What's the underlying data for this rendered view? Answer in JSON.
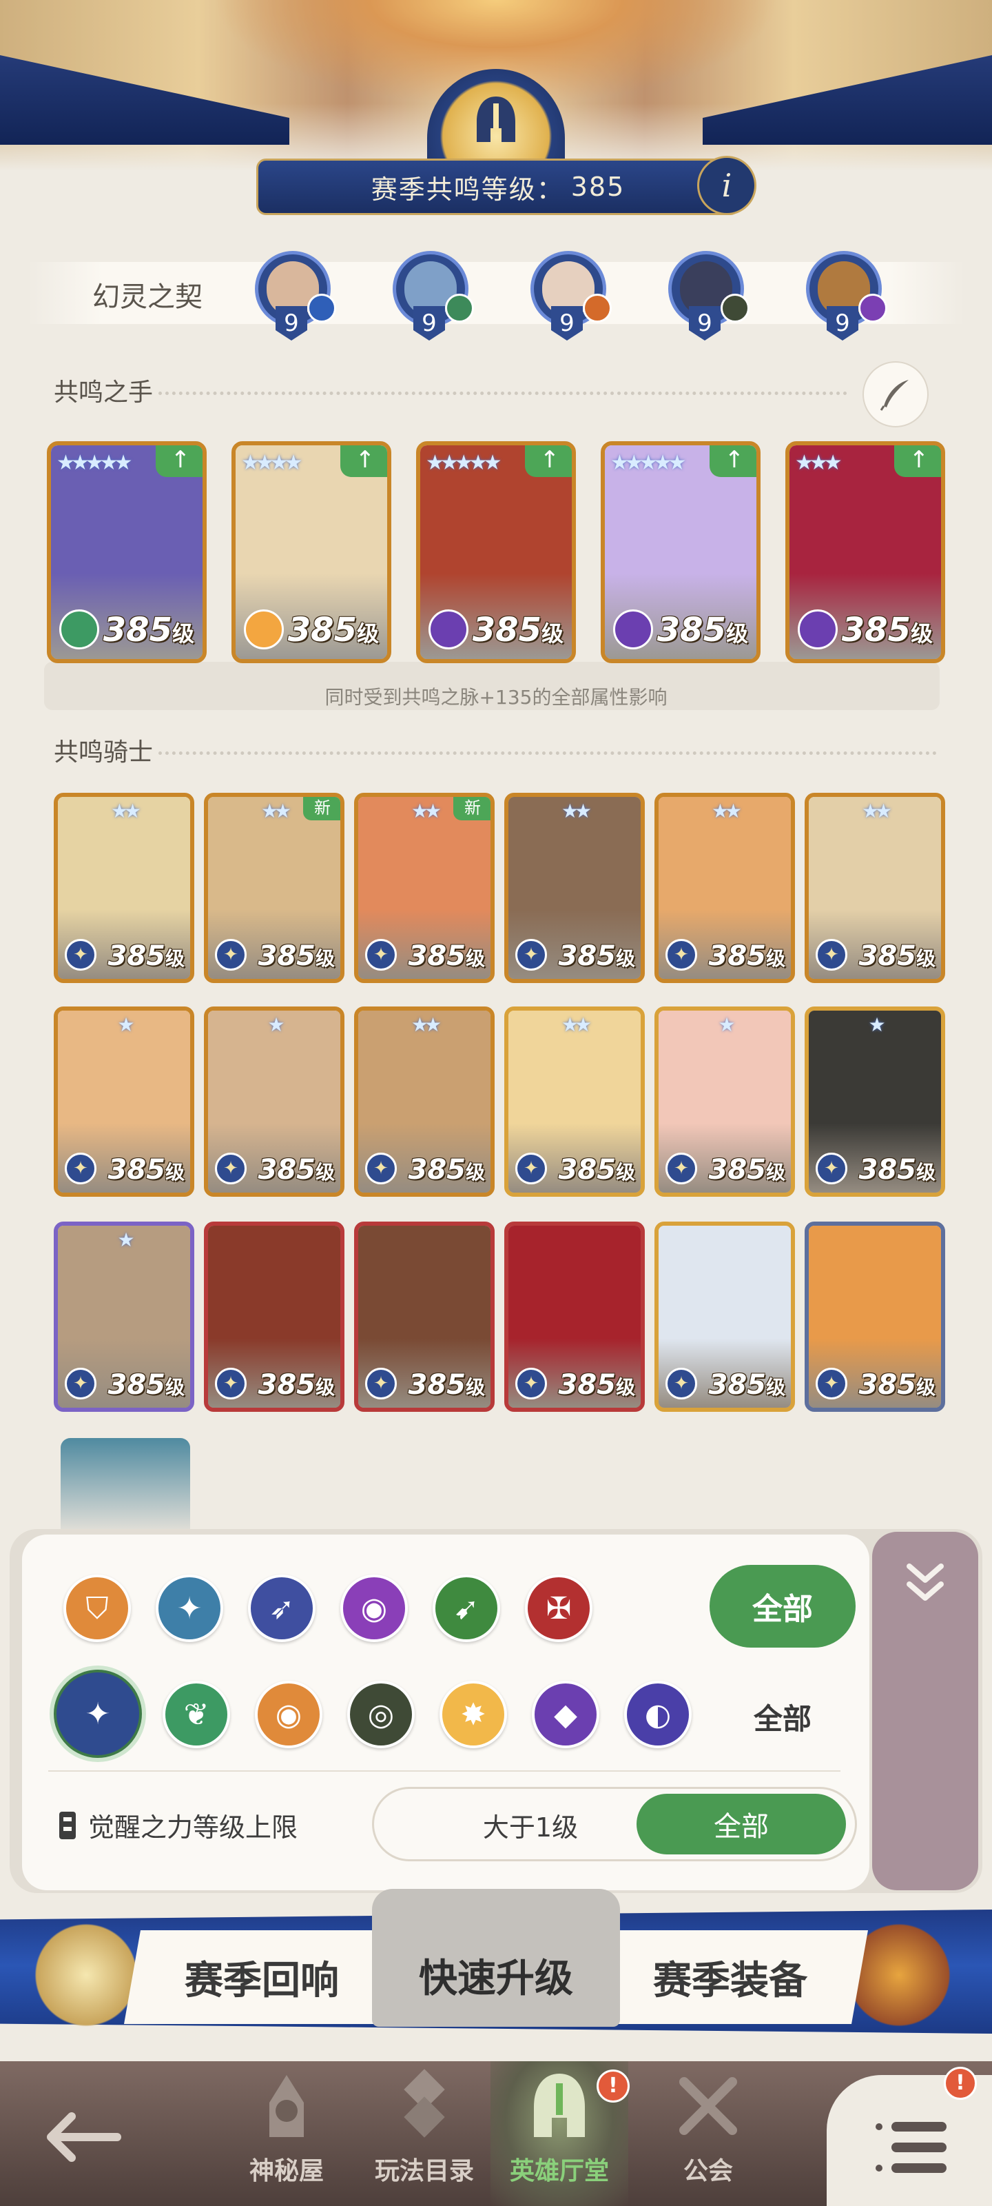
{
  "header": {
    "level_label": "赛季共鸣等级：",
    "level_value": "385",
    "info_label": "i"
  },
  "contract": {
    "title": "幻灵之契",
    "slots": [
      {
        "level": "9",
        "badge_color": "#2f5fb8",
        "face_color": "#d9b79c"
      },
      {
        "level": "9",
        "badge_color": "#3d8a5a",
        "face_color": "#7fa0c8"
      },
      {
        "level": "9",
        "badge_color": "#d46a2a",
        "face_color": "#e6d0bf"
      },
      {
        "level": "9",
        "badge_color": "#3f4a36",
        "face_color": "#3a3f5c"
      },
      {
        "level": "9",
        "badge_color": "#7b3fb3",
        "face_color": "#b07a3f"
      }
    ]
  },
  "hand": {
    "title": "共鸣之手",
    "note": "同时受到共鸣之脉+135的全部属性影响",
    "cards": [
      {
        "level": "385",
        "unit": "级",
        "stars": "★★★★★",
        "art": "#6a5fb3",
        "faction": "#3d9a63"
      },
      {
        "level": "385",
        "unit": "级",
        "stars": "★★★★",
        "art": "#e9d6b1",
        "faction": "#f3a640"
      },
      {
        "level": "385",
        "unit": "级",
        "stars": "★★★★★",
        "art": "#b0442f",
        "faction": "#6b3fb0"
      },
      {
        "level": "385",
        "unit": "级",
        "stars": "★★★★★",
        "art": "#c8b2e8",
        "faction": "#6b3fb0"
      },
      {
        "level": "385",
        "unit": "级",
        "stars": "★★★",
        "art": "#a8243f",
        "faction": "#6b3fb0"
      }
    ]
  },
  "knights": {
    "title": "共鸣骑士",
    "cards": [
      {
        "level": "385",
        "unit": "级",
        "stars": "★★",
        "new": "",
        "art": "#e6d3a3",
        "frame": "orange"
      },
      {
        "level": "385",
        "unit": "级",
        "stars": "★★",
        "new": "新",
        "art": "#d9b98a",
        "frame": "orange"
      },
      {
        "level": "385",
        "unit": "级",
        "stars": "★★",
        "new": "新",
        "art": "#e28a5c",
        "frame": "orange"
      },
      {
        "level": "385",
        "unit": "级",
        "stars": "★★",
        "new": "",
        "art": "#8a6c54",
        "frame": "orange"
      },
      {
        "level": "385",
        "unit": "级",
        "stars": "★★",
        "new": "",
        "art": "#e7a96b",
        "frame": "orange"
      },
      {
        "level": "385",
        "unit": "级",
        "stars": "★★",
        "new": "",
        "art": "#e3cfa8",
        "frame": "orange"
      },
      {
        "level": "385",
        "unit": "级",
        "stars": "★",
        "new": "",
        "art": "#e8b884",
        "frame": "orange"
      },
      {
        "level": "385",
        "unit": "级",
        "stars": "★",
        "new": "",
        "art": "#d6b48f",
        "frame": "orange"
      },
      {
        "level": "385",
        "unit": "级",
        "stars": "★★",
        "new": "",
        "art": "#caa071",
        "frame": "orange"
      },
      {
        "level": "385",
        "unit": "级",
        "stars": "★★",
        "new": "",
        "art": "#f0d59a",
        "frame": "gold"
      },
      {
        "level": "385",
        "unit": "级",
        "stars": "★",
        "new": "",
        "art": "#f2c7b8",
        "frame": "gold"
      },
      {
        "level": "385",
        "unit": "级",
        "stars": "★",
        "new": "",
        "art": "#3b3a36",
        "frame": "gold"
      },
      {
        "level": "385",
        "unit": "级",
        "stars": "★",
        "new": "",
        "art": "#b69c80",
        "frame": "purple"
      },
      {
        "level": "385",
        "unit": "级",
        "stars": "",
        "new": "",
        "art": "#8a3a2a",
        "frame": "red"
      },
      {
        "level": "385",
        "unit": "级",
        "stars": "",
        "new": "",
        "art": "#7a4a34",
        "frame": "red"
      },
      {
        "level": "385",
        "unit": "级",
        "stars": "",
        "new": "",
        "art": "#a7232c",
        "frame": "red"
      },
      {
        "level": "385",
        "unit": "级",
        "stars": "",
        "new": "",
        "art": "#dfe6ef",
        "frame": "gold"
      },
      {
        "level": "385",
        "unit": "级",
        "stars": "",
        "new": "",
        "art": "#e89a4a",
        "frame": "slate"
      }
    ]
  },
  "filter": {
    "row1_icons": [
      {
        "name": "shield-class-icon",
        "color": "#e08a3a",
        "glyph": "⛉"
      },
      {
        "name": "mage-class-icon",
        "color": "#3e7fa8",
        "glyph": "✦"
      },
      {
        "name": "ranger-class-icon",
        "color": "#3f4fa0",
        "glyph": "➶"
      },
      {
        "name": "support-class-icon",
        "color": "#8a3fb8",
        "glyph": "◉"
      },
      {
        "name": "assassin-class-icon",
        "color": "#3f8a3f",
        "glyph": "➹"
      },
      {
        "name": "warrior-class-icon",
        "color": "#b33030",
        "glyph": "✠"
      }
    ],
    "row2_icons": [
      {
        "name": "lightbearer-faction-icon",
        "color": "#2f4b8f",
        "glyph": "✦"
      },
      {
        "name": "wilder-faction-icon",
        "color": "#3d9a63",
        "glyph": "❦"
      },
      {
        "name": "graveborn-faction-icon",
        "color": "#e08a3a",
        "glyph": "◉"
      },
      {
        "name": "mauler-faction-icon",
        "color": "#3f4a36",
        "glyph": "◎"
      },
      {
        "name": "celestial-faction-icon",
        "color": "#f2b84a",
        "glyph": "✸"
      },
      {
        "name": "hypogean-faction-icon",
        "color": "#6b3fb0",
        "glyph": "◆"
      },
      {
        "name": "dimensional-faction-icon",
        "color": "#4a3fa8",
        "glyph": "◐"
      }
    ],
    "row1_all": "全部",
    "row2_all": "全部",
    "awaken_label": "觉醒之力等级上限",
    "awaken_value": "大于1级",
    "awaken_all": "全部"
  },
  "actions": {
    "left": "赛季回响",
    "middle": "快速升级",
    "right": "赛季装备"
  },
  "nav": {
    "items": [
      {
        "label": "神秘屋"
      },
      {
        "label": "玩法目录"
      },
      {
        "label": "英雄厅堂"
      },
      {
        "label": "公会"
      }
    ],
    "badge": "!"
  }
}
